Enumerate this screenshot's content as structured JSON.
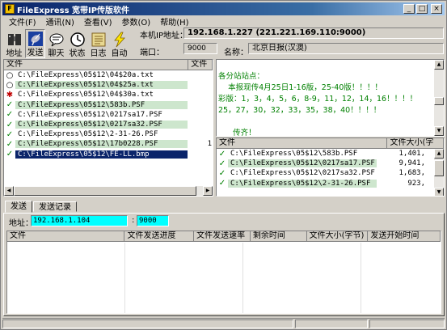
{
  "window": {
    "title": "FileExpress 宽带IP传版软件"
  },
  "menu": [
    "文件(F)",
    "通讯(N)",
    "查看(V)",
    "参数(O)",
    "帮助(H)"
  ],
  "toolbar": [
    {
      "label": "地址",
      "icon": "address-book-icon"
    },
    {
      "label": "发送",
      "icon": "satellite-dish-icon"
    },
    {
      "label": "聊天",
      "icon": "chat-bubble-icon"
    },
    {
      "label": "状态",
      "icon": "clock-icon"
    },
    {
      "label": "日志",
      "icon": "log-book-icon"
    },
    {
      "label": "自动",
      "icon": "lightning-icon"
    }
  ],
  "info": {
    "ip_label": "本机IP地址：",
    "ip_value": "192.168.1.227  (221.221.169.110:9000)",
    "port_label": "端口：",
    "port_value": "9000",
    "name_label": "名称：",
    "name_value": "北京日报(汉澳)"
  },
  "left_list": {
    "columns": [
      "文件",
      "文件"
    ],
    "rows": [
      {
        "status": "○",
        "name": "C:\\FileExpress\\05$12\\04$20a.txt",
        "green": false,
        "selected": false
      },
      {
        "status": "○",
        "name": "C:\\FileExpress\\05$12\\04$25a.txt",
        "green": true,
        "selected": false
      },
      {
        "status": "✱",
        "name": "C:\\FileExpress\\05$12\\04$30a.txt",
        "green": false,
        "selected": false
      },
      {
        "status": "✓",
        "name": "C:\\FileExpress\\05$12\\583b.PSF",
        "green": true,
        "selected": false
      },
      {
        "status": "✓",
        "name": "C:\\FileExpress\\05$12\\0217sa17.PSF",
        "green": false,
        "selected": false
      },
      {
        "status": "✓",
        "name": "C:\\FileExpress\\05$12\\0217sa32.PSF",
        "green": true,
        "selected": false
      },
      {
        "status": "✓",
        "name": "C:\\FileExpress\\05$12\\2-31-26.PSF",
        "green": false,
        "selected": false
      },
      {
        "status": "✓",
        "name": "C:\\FileExpress\\05$12\\17b0228.PSF",
        "green": true,
        "selected": false
      },
      {
        "status": "✓",
        "name": "C:\\FileExpress\\05$12\\FE-LL.bmp",
        "green": false,
        "selected": true
      }
    ],
    "second_col_values": [
      "",
      "",
      "",
      "",
      "",
      "",
      "",
      "1",
      ""
    ]
  },
  "message": {
    "lines": [
      "各分站站点：",
      "    本报现传4月25日1-16版，25-40版！！！！",
      "彩版：1，3，4，5，6，8-9，11，12，14，16！！！！",
      "25，27，30，32，33，35，38，40！！！！",
      "",
      "      传齐！"
    ]
  },
  "right_list": {
    "columns": [
      "文件",
      "文件大小(字"
    ],
    "rows": [
      {
        "name": "C:\\FileExpress\\05$12\\583b.PSF",
        "size": "1,401,",
        "green": false
      },
      {
        "name": "C:\\FileExpress\\05$12\\0217sa17.PSF",
        "size": "9,941,",
        "green": true
      },
      {
        "name": "C:\\FileExpress\\05$12\\0217sa32.PSF",
        "size": "1,683,",
        "green": false
      },
      {
        "name": "C:\\FileExpress\\05$12\\2-31-26.PSF",
        "size": "923,",
        "green": true
      }
    ]
  },
  "send": {
    "tabs": [
      "发送",
      "发送记录"
    ],
    "address_label": "地址：",
    "address_value": "192.168.1.104",
    "port_sep": ":",
    "port_value": "9000",
    "columns": [
      "文件",
      "文件发送进度",
      "文件发送速率",
      "剩余时间",
      "文件大小(字节)",
      "发送开始时间"
    ]
  },
  "colors": {
    "titlebar": "#0a246a",
    "face": "#d4d0c8",
    "row_green": "#cde6cd",
    "message_text": "#008000",
    "cyan_input": "#00ffff",
    "selection": "#0a246a"
  }
}
